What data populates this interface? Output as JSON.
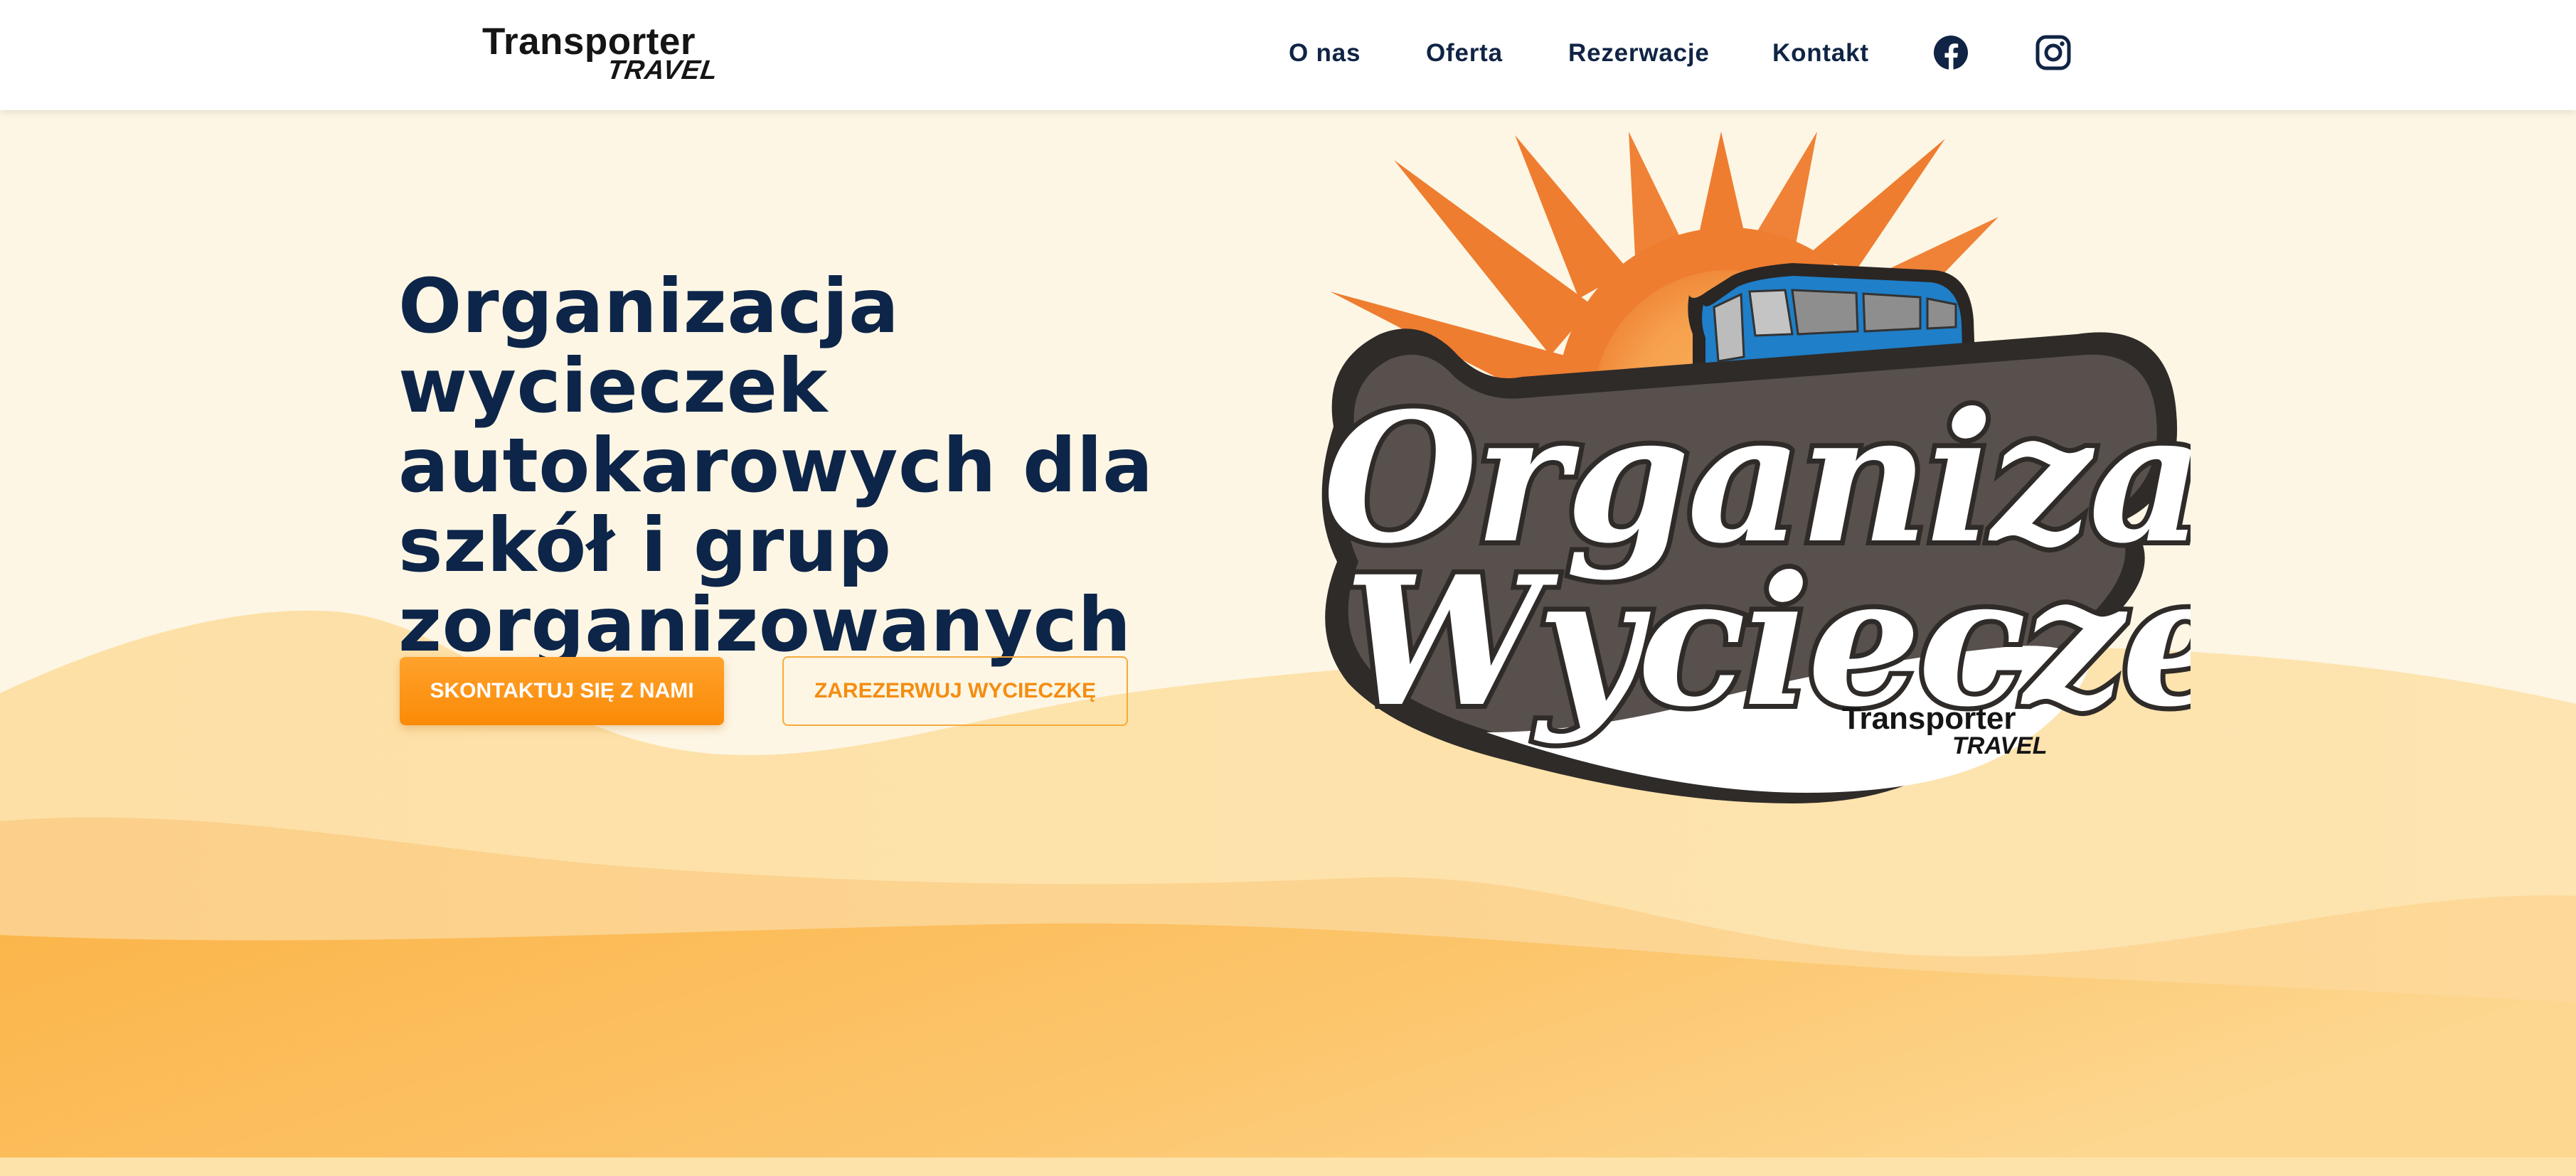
{
  "header": {
    "logo": {
      "main": "Transporter",
      "sub": "TRAVEL"
    },
    "nav": [
      {
        "label": "O nas"
      },
      {
        "label": "Oferta"
      },
      {
        "label": "Rezerwacje"
      },
      {
        "label": "Kontakt"
      }
    ],
    "social": [
      {
        "icon": "facebook-icon"
      },
      {
        "icon": "instagram-icon"
      }
    ]
  },
  "hero": {
    "title_lines": [
      "Organizacja wycieczek",
      "autokarowych dla",
      "szkół i grup",
      "zorganizowanych"
    ],
    "primary_button": "SKONTAKTUJ SIĘ Z NAMI",
    "secondary_button": "ZAREZERWUJ WYCIECZKĘ",
    "illustration": {
      "line1": "Organizacja",
      "line2": "Wycieczek",
      "brand_main": "Transporter",
      "brand_sub": "TRAVEL"
    }
  },
  "colors": {
    "navy": "#0d2549",
    "accent_orange": "#fb8a06",
    "background_cream": "#fdf6e4",
    "sun_orange": "#ee7d30",
    "bus_blue": "#1f7fc8"
  }
}
